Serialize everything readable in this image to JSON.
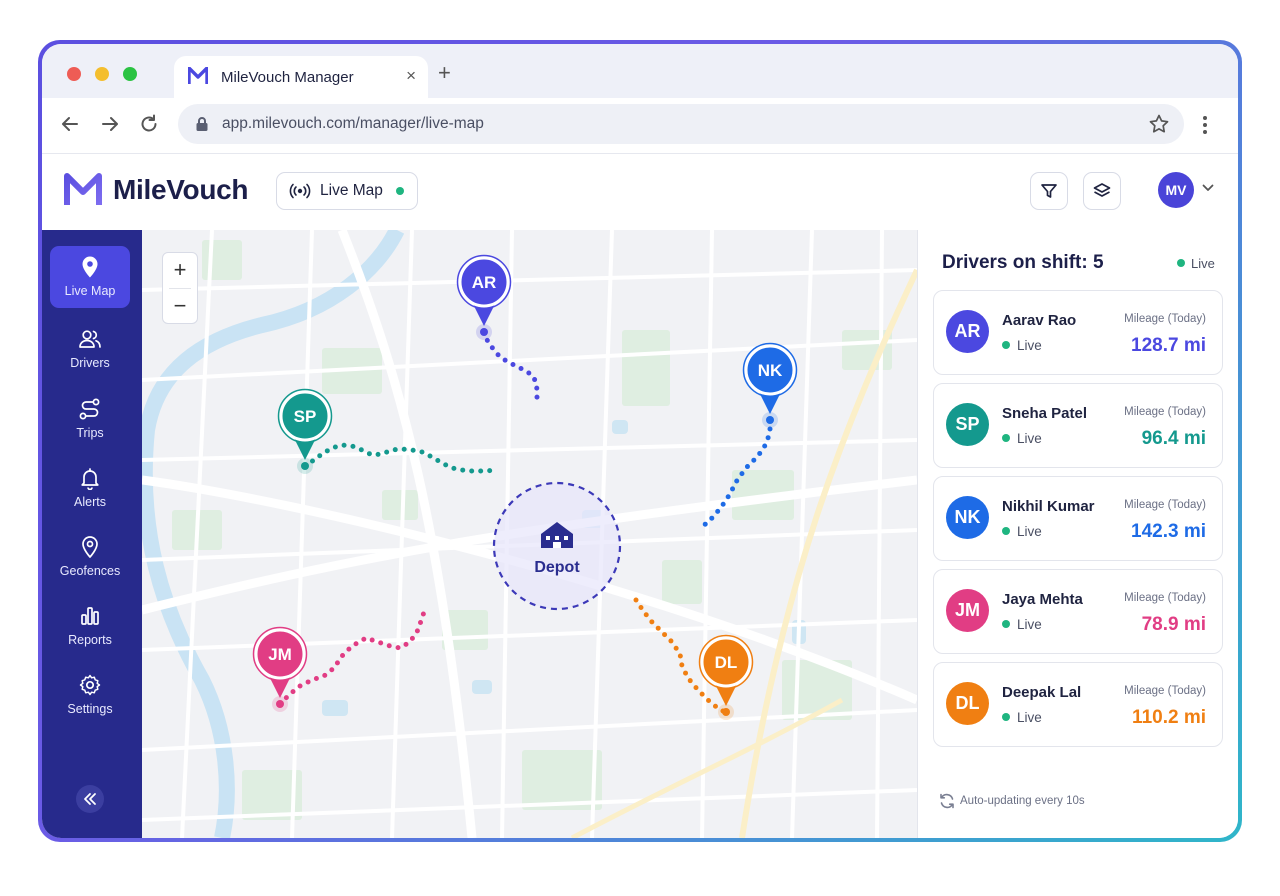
{
  "browser": {
    "tab_title": "MileVouch Manager",
    "tab_close": "×",
    "new_tab": "+",
    "url": "app.milevouch.com/manager/live-map"
  },
  "header": {
    "brand": "MileVouch",
    "live_map_pill": "Live Map",
    "avatar_initials": "MV"
  },
  "sidebar": {
    "items": [
      {
        "label": "Live Map",
        "icon": "map-pin-icon",
        "active": true
      },
      {
        "label": "Drivers",
        "icon": "users-icon"
      },
      {
        "label": "Trips",
        "icon": "route-icon"
      },
      {
        "label": "Alerts",
        "icon": "bell-icon"
      },
      {
        "label": "Geofences",
        "icon": "geofence-pin-icon"
      },
      {
        "label": "Reports",
        "icon": "bar-chart-icon"
      },
      {
        "label": "Settings",
        "icon": "gear-icon"
      }
    ]
  },
  "map": {
    "zoom_in": "+",
    "zoom_out": "−",
    "depot_label": "Depot",
    "markers": [
      {
        "initials": "AR",
        "color": "#4b48e0"
      },
      {
        "initials": "SP",
        "color": "#14998e"
      },
      {
        "initials": "NK",
        "color": "#1e6be6"
      },
      {
        "initials": "JM",
        "color": "#e13d84"
      },
      {
        "initials": "DL",
        "color": "#f07f12"
      }
    ]
  },
  "panel": {
    "title": "Drivers on shift: 5",
    "live": "Live",
    "mileage_label": "Mileage (Today)",
    "drivers": [
      {
        "initials": "AR",
        "name": "Aarav Rao",
        "status": "Live",
        "mileage": "128.7 mi",
        "color": "#4b48e0"
      },
      {
        "initials": "SP",
        "name": "Sneha Patel",
        "status": "Live",
        "mileage": "96.4 mi",
        "color": "#14998e"
      },
      {
        "initials": "NK",
        "name": "Nikhil Kumar",
        "status": "Live",
        "mileage": "142.3 mi",
        "color": "#1e6be6"
      },
      {
        "initials": "JM",
        "name": "Jaya Mehta",
        "status": "Live",
        "mileage": "78.9 mi",
        "color": "#e13d84"
      },
      {
        "initials": "DL",
        "name": "Deepak Lal",
        "status": "Live",
        "mileage": "110.2 mi",
        "color": "#f07f12"
      }
    ],
    "auto_update": "Auto-updating every 10s"
  }
}
